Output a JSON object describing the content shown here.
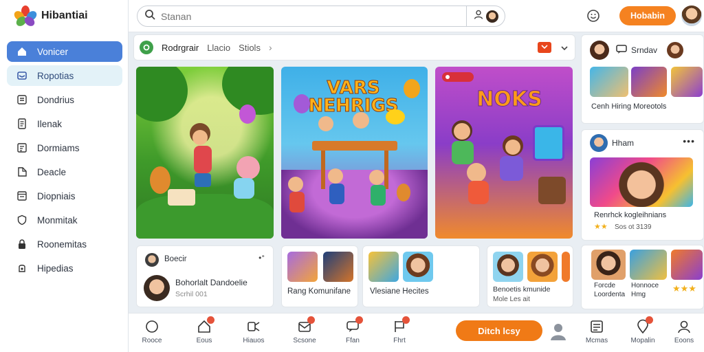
{
  "app": {
    "title": "Hibantiai"
  },
  "sidebar": {
    "items": [
      {
        "label": "Vonicer",
        "icon": "home-icon"
      },
      {
        "label": "Ropotias",
        "icon": "inbox-icon"
      },
      {
        "label": "Dondrius",
        "icon": "list-icon"
      },
      {
        "label": "Ilenak",
        "icon": "document-icon"
      },
      {
        "label": "Dormiams",
        "icon": "grid-icon"
      },
      {
        "label": "Deacle",
        "icon": "tag-icon"
      },
      {
        "label": "Diopniais",
        "icon": "folder-icon"
      },
      {
        "label": "Monmitak",
        "icon": "shield-icon"
      },
      {
        "label": "Roonemitas",
        "icon": "lock-icon"
      },
      {
        "label": "Hipedias",
        "icon": "settings-icon"
      }
    ]
  },
  "search": {
    "placeholder": "Stanan"
  },
  "header": {
    "action_button": "Hobabin"
  },
  "feed": {
    "tabs": [
      {
        "label": "Rodrgrair"
      },
      {
        "label": "Llacio"
      },
      {
        "label": "Stiols"
      }
    ],
    "hero_cards": [
      {
        "title": ""
      },
      {
        "title": "VARS NEHRIGS"
      },
      {
        "title": "NOKS"
      }
    ],
    "bottom_cards": [
      {
        "header": "Boecir",
        "name": "Bohorlalt Dandoelie",
        "subtitle": "Scrhil 001"
      },
      {
        "caption": "Rang Komunifane"
      },
      {
        "caption": "Vlesiane Hecites"
      },
      {
        "name": "Benoetis kmunide",
        "subtitle": "Mole Les ait"
      }
    ]
  },
  "right_panel": {
    "card1": {
      "title": "Srndav",
      "caption": "Cenh Hiring Moreotols"
    },
    "card2": {
      "title": "Hham",
      "caption": "Renrhck kogleihnians",
      "meta": "Sos ot 3139"
    },
    "card3": {
      "captions": [
        "Forcde",
        "Honnoce",
        "Loordenta",
        "Hmg"
      ]
    }
  },
  "bottom_nav": {
    "items": [
      {
        "label": "Rooce"
      },
      {
        "label": "Eous"
      },
      {
        "label": "Hiauos"
      },
      {
        "label": "Scsone"
      },
      {
        "label": "Ffan"
      },
      {
        "label": "Fhrt"
      },
      {
        "label": "Mcmas"
      },
      {
        "label": "Mopalin"
      },
      {
        "label": "Eoons"
      }
    ],
    "cta": "Ditch lcsy"
  },
  "colors": {
    "primary": "#4a80d9",
    "accent": "#f58220",
    "success": "#3fa04a",
    "bg": "#e9eef3"
  }
}
